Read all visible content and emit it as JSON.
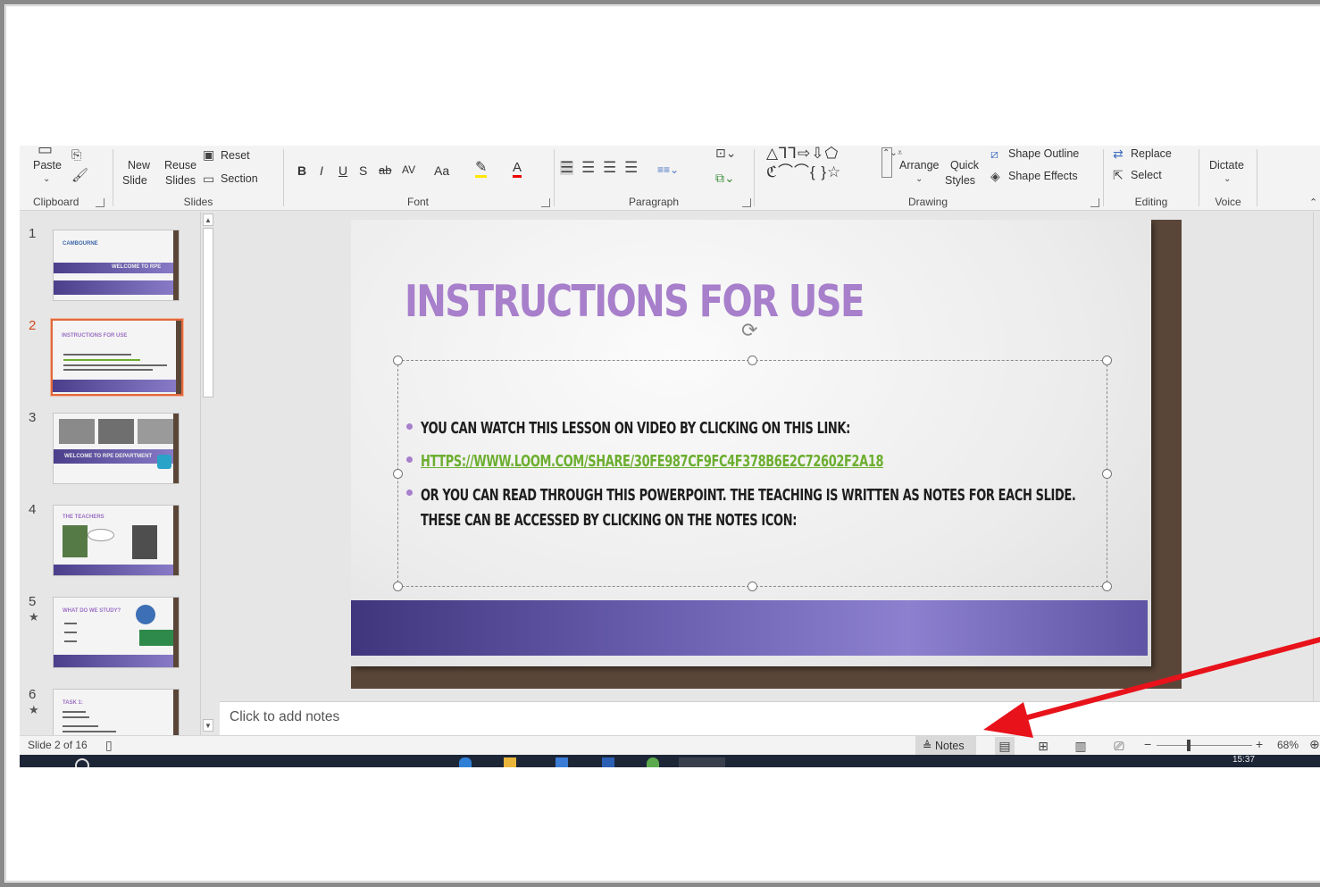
{
  "ribbon": {
    "clipboard": {
      "paste": "Paste",
      "label": "Clipboard"
    },
    "slides": {
      "new_1": "New",
      "new_2": "Slide",
      "reuse_1": "Reuse",
      "reuse_2": "Slides",
      "reset": "Reset",
      "section": "Section",
      "label": "Slides"
    },
    "font": {
      "bold": "B",
      "italic": "I",
      "underline": "U",
      "shadow": "S",
      "strike": "ab",
      "spacing": "AV",
      "case": "Aa",
      "highlight": "✎",
      "color": "A",
      "label": "Font"
    },
    "paragraph": {
      "label": "Paragraph"
    },
    "drawing": {
      "shapes_row1": "△⅂⅂⇨⇩⬠",
      "shapes_row2": "ℭ⌒⌒{ }☆",
      "arrange": "Arrange",
      "quick_1": "Quick",
      "quick_2": "Styles",
      "outline": "Shape Outline",
      "effects": "Shape Effects",
      "label": "Drawing"
    },
    "editing": {
      "replace": "Replace",
      "select": "Select",
      "label": "Editing"
    },
    "voice": {
      "dictate": "Dictate",
      "label": "Voice"
    }
  },
  "thumbnails": {
    "items": [
      {
        "num": "1",
        "title": "WELCOME TO RPE",
        "logo": "CAMBOURNE"
      },
      {
        "num": "2",
        "title": "INSTRUCTIONS FOR USE"
      },
      {
        "num": "3",
        "title": "WELCOME TO RPE DEPARTMENT"
      },
      {
        "num": "4",
        "title": "THE TEACHERS"
      },
      {
        "num": "5",
        "title": "WHAT DO WE STUDY?"
      },
      {
        "num": "6",
        "title": "TASK 1:"
      }
    ],
    "star": "★"
  },
  "slide": {
    "title": "INSTRUCTIONS FOR USE",
    "bullet1": "YOU CAN WATCH THIS LESSON ON VIDEO BY CLICKING ON THIS LINK:",
    "bullet2": "HTTPS://WWW.LOOM.COM/SHARE/30FE987CF9FC4F378B6E2C72602F2A18",
    "bullet3_line1": "OR YOU CAN READ THROUGH THIS POWERPOINT. THE TEACHING IS WRITTEN AS NOTES FOR EACH SLIDE.",
    "bullet3_line2": "THESE CAN BE ACCESSED BY CLICKING ON THE NOTES ICON:"
  },
  "notes": {
    "placeholder": "Click to add notes"
  },
  "status": {
    "slide_info": "Slide 2 of 16",
    "notes_button": "Notes",
    "zoom_minus": "−",
    "zoom_plus": "+",
    "zoom_level": "68%",
    "zoom_value": 0.68
  },
  "taskbar": {
    "time": "15:37"
  },
  "colors": {
    "accent_purple": "#a77fcb",
    "link_green": "#6cae2f",
    "active_thumb": "#e0693c",
    "annotation_red": "#e8121b"
  }
}
